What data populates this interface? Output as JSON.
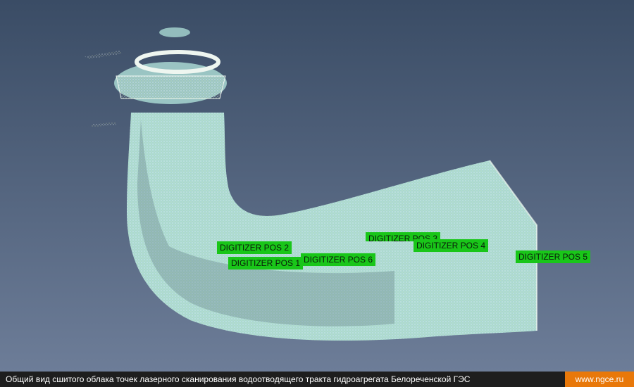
{
  "viewport": {
    "colors": {
      "background_top": "#3a4c65",
      "background_bottom": "#6d7d98",
      "cloud_light": "#eef6f0",
      "cloud_mid": "#a9d8d2",
      "cloud_yellow": "#e5edb2",
      "cloud_dark": "#5f7c84",
      "marker_fill": "#19c619"
    },
    "markers": [
      {
        "label": "DIGITIZER POS 2"
      },
      {
        "label": "DIGITIZER POS 1"
      },
      {
        "label": "DIGITIZER POS 6"
      },
      {
        "label": "DIGITIZER POS 3"
      },
      {
        "label": "DIGITIZER POS 4"
      },
      {
        "label": "DIGITIZER POS 5"
      }
    ]
  },
  "caption": {
    "text": "Общий вид сшитого облака точек лазерного сканирования водоотводящего тракта гидроагрегата Белореченской ГЭС",
    "site": "www.ngce.ru",
    "colors": {
      "bar": "#1e1e1e",
      "site_bg": "#e8780a"
    }
  }
}
